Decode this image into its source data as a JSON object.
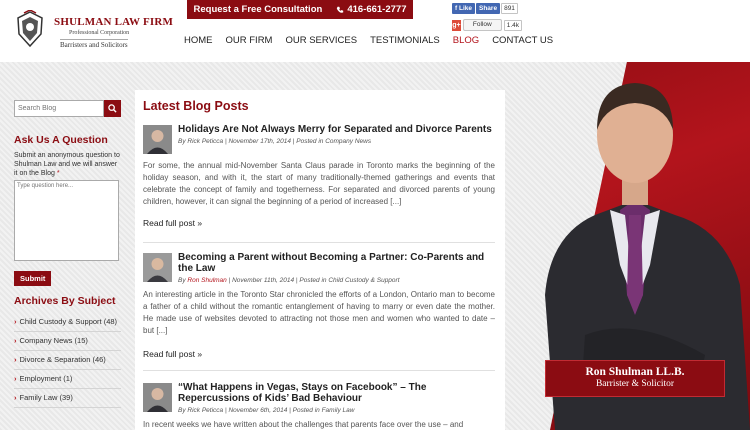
{
  "header": {
    "firm_name": "SHULMAN LAW FIRM",
    "firm_sub": "Professional Corporation",
    "firm_tagline": "Barristers and Solicitors",
    "consult_label": "Request a Free Consultation",
    "phone": "416-661-2777",
    "fb_like": "Like",
    "fb_share": "Share",
    "fb_count": "891",
    "gp_follow": "Follow",
    "gp_count": "1.4k",
    "nav": [
      "HOME",
      "OUR FIRM",
      "OUR SERVICES",
      "TESTIMONIALS",
      "BLOG",
      "CONTACT US"
    ],
    "active_nav": "BLOG"
  },
  "sidebar": {
    "search_placeholder": "Search Blog",
    "ask_title": "Ask Us A Question",
    "ask_desc": "Submit an anonymous question to Shulman Law and we will answer it on the Blog",
    "ask_required": "*",
    "ask_placeholder": "Type question here...",
    "submit_label": "Submit",
    "archives_title": "Archives By Subject",
    "archives": [
      {
        "label": "Child Custody & Support (48)"
      },
      {
        "label": "Company News (15)"
      },
      {
        "label": "Divorce & Separation (46)"
      },
      {
        "label": "Employment (1)"
      },
      {
        "label": "Family Law (39)"
      }
    ]
  },
  "main": {
    "title": "Latest Blog Posts",
    "posts": [
      {
        "title": "Holidays Are Not Always Merry for Separated and Divorce Parents",
        "by": "By ",
        "author": "Rick Peticca",
        "rest_meta": " | November 17th, 2014 | Posted in Company News",
        "excerpt": "For some, the annual mid-November Santa Claus parade in Toronto marks the beginning of the holiday season, and with it, the start of many traditionally-themed gatherings and events that celebrate the concept of family and togetherness. For separated and divorced parents of young children, however, it can signal the beginning of a period of increased [...]",
        "readmore": "Read full post »"
      },
      {
        "title": "Becoming a Parent without Becoming a Partner: Co-Parents and the Law",
        "by": "By ",
        "author": "Ron Shulman",
        "rest_meta": " | November 11th, 2014 | Posted in Child Custody & Support",
        "excerpt": "An interesting article in the Toronto Star chronicled the efforts of a London, Ontario man to become a father of a child without the romantic entanglement of having to marry or even date the mother.     He made use of websites devoted to attracting not those men and women who wanted to date – but [...]",
        "readmore": "Read full post »"
      },
      {
        "title": "“What Happens in Vegas, Stays on Facebook” – The Repercussions of Kids’ Bad Behaviour",
        "by": "By ",
        "author": "Rick Peticca",
        "rest_meta": " | November 6th, 2014 | Posted in Family Law",
        "excerpt": "In recent weeks we have written about the challenges that parents face over the use – and"
      }
    ]
  },
  "nameplate": {
    "name": "Ron Shulman LL.B.",
    "title": "Barrister & Solicitor"
  },
  "colors": {
    "brand_red": "#8b0c12",
    "accent_red": "#b3141c",
    "fb_blue": "#4267b2",
    "gp_red": "#dd4b39"
  }
}
